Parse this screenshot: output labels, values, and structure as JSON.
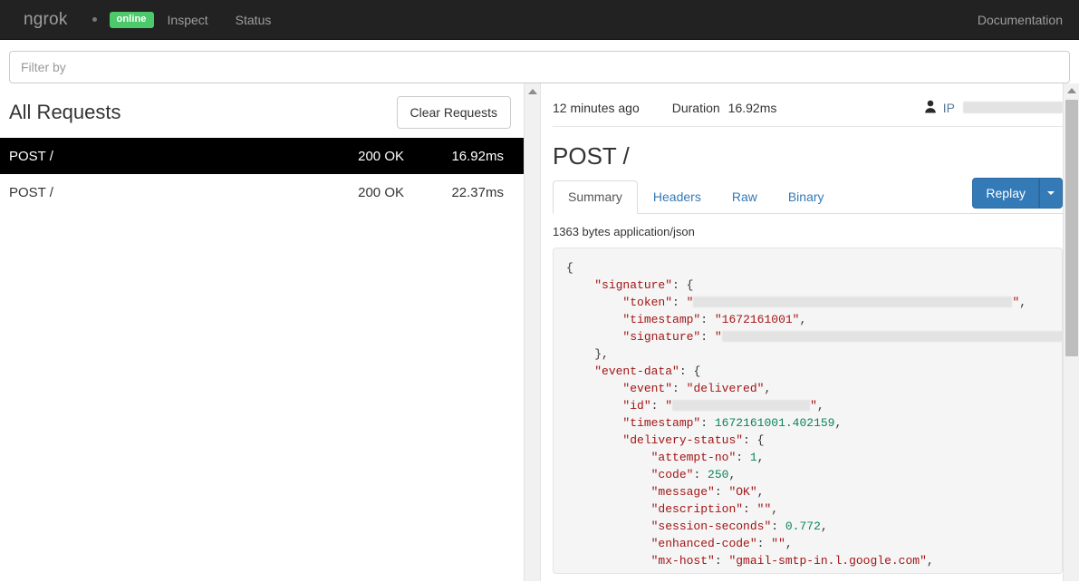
{
  "navbar": {
    "brand": "ngrok",
    "status_badge": "online",
    "links": [
      {
        "label": "Inspect"
      },
      {
        "label": "Status"
      }
    ],
    "right_link": "Documentation",
    "colors": {
      "background": "#222222",
      "badge_green": "#4cc96a",
      "link": "#9d9d9d"
    }
  },
  "filter": {
    "placeholder": "Filter by",
    "value": ""
  },
  "requests_panel": {
    "title": "All Requests",
    "clear_button": "Clear Requests",
    "columns": [
      "path",
      "status",
      "duration"
    ],
    "rows": [
      {
        "path": "POST /",
        "status": "200 OK",
        "duration": "16.92ms",
        "selected": true
      },
      {
        "path": "POST /",
        "status": "200 OK",
        "duration": "22.37ms",
        "selected": false
      }
    ]
  },
  "detail": {
    "time_ago": "12 minutes ago",
    "duration_label": "Duration",
    "duration_value": "16.92ms",
    "ip_label": "IP",
    "ip_value": "",
    "title": "POST /",
    "tabs": [
      {
        "label": "Summary",
        "active": true
      },
      {
        "label": "Headers",
        "active": false
      },
      {
        "label": "Raw",
        "active": false
      },
      {
        "label": "Binary",
        "active": false
      }
    ],
    "replay_button": "Replay",
    "body_meta": "1363 bytes application/json",
    "colors": {
      "primary": "#337ab7",
      "code_bg": "#f5f5f5"
    }
  },
  "json_body": {
    "lines": [
      {
        "indent": 0,
        "parts": [
          {
            "t": "punct",
            "v": "{"
          }
        ]
      },
      {
        "indent": 1,
        "parts": [
          {
            "t": "str",
            "v": "\"signature\""
          },
          {
            "t": "punct",
            "v": ": {"
          }
        ]
      },
      {
        "indent": 2,
        "parts": [
          {
            "t": "str",
            "v": "\"token\""
          },
          {
            "t": "punct",
            "v": ": "
          },
          {
            "t": "str",
            "v": "\""
          },
          {
            "t": "redact",
            "v": 352
          },
          {
            "t": "str",
            "v": "\""
          },
          {
            "t": "punct",
            "v": ","
          }
        ]
      },
      {
        "indent": 2,
        "parts": [
          {
            "t": "str",
            "v": "\"timestamp\""
          },
          {
            "t": "punct",
            "v": ": "
          },
          {
            "t": "str",
            "v": "\"1672161001\""
          },
          {
            "t": "punct",
            "v": ","
          }
        ]
      },
      {
        "indent": 2,
        "parts": [
          {
            "t": "str",
            "v": "\"signature\""
          },
          {
            "t": "punct",
            "v": ": "
          },
          {
            "t": "str",
            "v": "\""
          },
          {
            "t": "redact",
            "v": 380
          },
          {
            "t": "str",
            "v": "\""
          }
        ]
      },
      {
        "indent": 1,
        "parts": [
          {
            "t": "punct",
            "v": "},"
          }
        ]
      },
      {
        "indent": 1,
        "parts": [
          {
            "t": "str",
            "v": "\"event-data\""
          },
          {
            "t": "punct",
            "v": ": {"
          }
        ]
      },
      {
        "indent": 2,
        "parts": [
          {
            "t": "str",
            "v": "\"event\""
          },
          {
            "t": "punct",
            "v": ": "
          },
          {
            "t": "str",
            "v": "\"delivered\""
          },
          {
            "t": "punct",
            "v": ","
          }
        ]
      },
      {
        "indent": 2,
        "parts": [
          {
            "t": "str",
            "v": "\"id\""
          },
          {
            "t": "punct",
            "v": ": "
          },
          {
            "t": "str",
            "v": "\""
          },
          {
            "t": "redact",
            "v": 152
          },
          {
            "t": "str",
            "v": "\""
          },
          {
            "t": "punct",
            "v": ","
          }
        ]
      },
      {
        "indent": 2,
        "parts": [
          {
            "t": "str",
            "v": "\"timestamp\""
          },
          {
            "t": "punct",
            "v": ": "
          },
          {
            "t": "num",
            "v": "1672161001.402159"
          },
          {
            "t": "punct",
            "v": ","
          }
        ]
      },
      {
        "indent": 2,
        "parts": [
          {
            "t": "str",
            "v": "\"delivery-status\""
          },
          {
            "t": "punct",
            "v": ": {"
          }
        ]
      },
      {
        "indent": 3,
        "parts": [
          {
            "t": "str",
            "v": "\"attempt-no\""
          },
          {
            "t": "punct",
            "v": ": "
          },
          {
            "t": "num",
            "v": "1"
          },
          {
            "t": "punct",
            "v": ","
          }
        ]
      },
      {
        "indent": 3,
        "parts": [
          {
            "t": "str",
            "v": "\"code\""
          },
          {
            "t": "punct",
            "v": ": "
          },
          {
            "t": "num",
            "v": "250"
          },
          {
            "t": "punct",
            "v": ","
          }
        ]
      },
      {
        "indent": 3,
        "parts": [
          {
            "t": "str",
            "v": "\"message\""
          },
          {
            "t": "punct",
            "v": ": "
          },
          {
            "t": "str",
            "v": "\"OK\""
          },
          {
            "t": "punct",
            "v": ","
          }
        ]
      },
      {
        "indent": 3,
        "parts": [
          {
            "t": "str",
            "v": "\"description\""
          },
          {
            "t": "punct",
            "v": ": "
          },
          {
            "t": "str",
            "v": "\"\""
          },
          {
            "t": "punct",
            "v": ","
          }
        ]
      },
      {
        "indent": 3,
        "parts": [
          {
            "t": "str",
            "v": "\"session-seconds\""
          },
          {
            "t": "punct",
            "v": ": "
          },
          {
            "t": "num",
            "v": "0.772"
          },
          {
            "t": "punct",
            "v": ","
          }
        ]
      },
      {
        "indent": 3,
        "parts": [
          {
            "t": "str",
            "v": "\"enhanced-code\""
          },
          {
            "t": "punct",
            "v": ": "
          },
          {
            "t": "str",
            "v": "\"\""
          },
          {
            "t": "punct",
            "v": ","
          }
        ]
      },
      {
        "indent": 3,
        "parts": [
          {
            "t": "str",
            "v": "\"mx-host\""
          },
          {
            "t": "punct",
            "v": ": "
          },
          {
            "t": "str",
            "v": "\"gmail-smtp-in.l.google.com\""
          },
          {
            "t": "punct",
            "v": ","
          }
        ]
      }
    ]
  }
}
